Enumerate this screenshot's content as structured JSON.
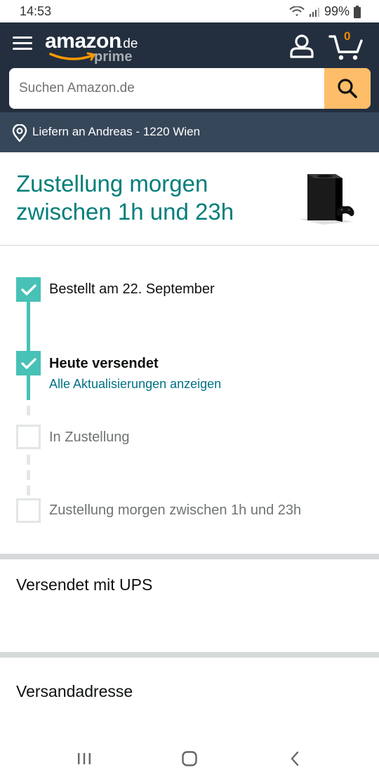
{
  "status_bar": {
    "time": "14:53",
    "battery": "99%",
    "icons": [
      "wifi-icon",
      "signal-icon",
      "battery-icon"
    ]
  },
  "header": {
    "logo_word": "amazon",
    "logo_tld": ".de",
    "logo_sub": "prime",
    "cart_count": "0",
    "icons": [
      "menu-icon",
      "account-icon",
      "cart-icon"
    ]
  },
  "search": {
    "placeholder": "Suchen Amazon.de",
    "value": ""
  },
  "delivery": {
    "text": "Liefern an Andreas - 1220 Wien"
  },
  "shipment": {
    "headline": "Zustellung morgen zwischen 1h und 23h",
    "steps": [
      {
        "label": "Bestellt am 22. September",
        "status": "done"
      },
      {
        "label": "Heute versendet",
        "status": "done",
        "link": "Alle Aktualisierungen anzeigen"
      },
      {
        "label": "In Zustellung",
        "status": "pending"
      },
      {
        "label": "Zustellung morgen zwischen 1h und 23h",
        "status": "pending"
      }
    ]
  },
  "sections": {
    "carrier_title": "Versendet mit UPS",
    "address_title": "Versandadresse"
  },
  "colors": {
    "header_bg": "#232f3e",
    "deliver_bg": "#37475a",
    "search_button": "#febd69",
    "teal": "#007e7a",
    "timeline": "#48c1b6",
    "link": "#007185",
    "cart_count": "#f08804"
  }
}
